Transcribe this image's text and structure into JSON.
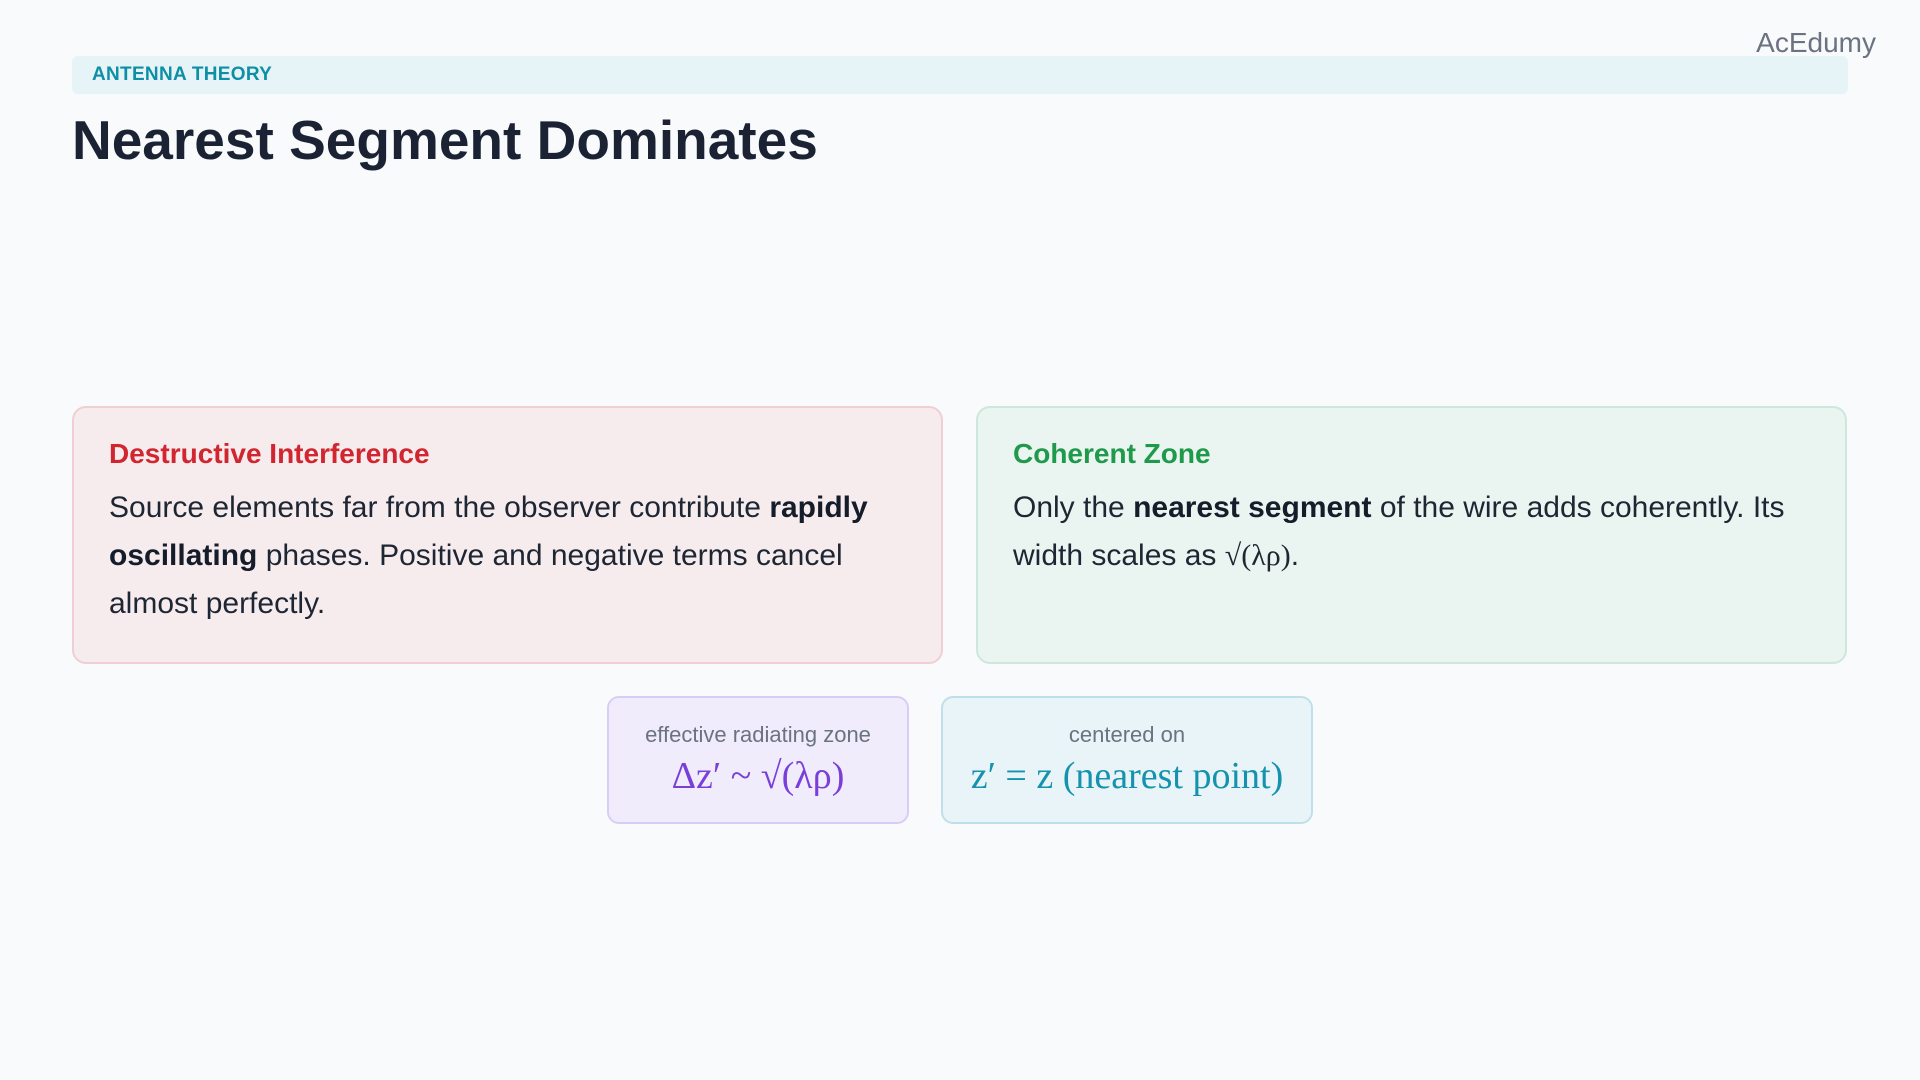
{
  "brand": "AcEdumy",
  "topic": "ANTENNA THEORY",
  "title": "Nearest Segment Dominates",
  "cards": [
    {
      "title": "Destructive Interference",
      "body_parts": [
        "Source elements far from the observer contribute ",
        "rapidly oscillating",
        " phases. Positive and negative terms cancel almost perfectly."
      ],
      "accent_color": "#d1262f"
    },
    {
      "title": "Coherent Zone",
      "body_parts": [
        "Only the ",
        "nearest segment",
        " of the wire adds coherently. Its width scales as ",
        "√(λρ)",
        "."
      ],
      "accent_color": "#1e9a4a"
    }
  ],
  "formulas": [
    {
      "caption": "effective radiating zone",
      "expression": "Δz′ ~ √(λρ)",
      "color": "#7b3fd9"
    },
    {
      "caption": "centered on",
      "expression": "z′ = z (nearest point)",
      "color": "#1592ad"
    }
  ]
}
